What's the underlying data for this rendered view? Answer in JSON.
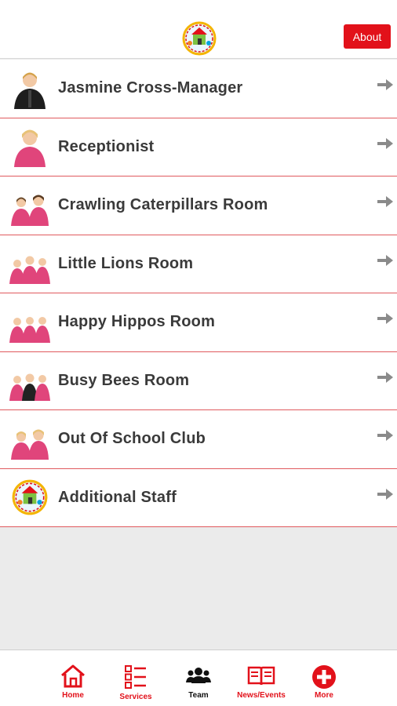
{
  "header": {
    "about_label": "About"
  },
  "items": [
    {
      "label": "Jasmine Cross-Manager",
      "thumb": "person-single-black"
    },
    {
      "label": "Receptionist",
      "thumb": "person-single-pink"
    },
    {
      "label": "Crawling Caterpillars Room",
      "thumb": "people-two-pink"
    },
    {
      "label": "Little Lions Room",
      "thumb": "people-three-pink"
    },
    {
      "label": "Happy Hippos Room",
      "thumb": "people-three-pink"
    },
    {
      "label": "Busy Bees Room",
      "thumb": "people-three-mixed"
    },
    {
      "label": "Out Of School Club",
      "thumb": "people-two-pink"
    },
    {
      "label": "Additional Staff",
      "thumb": "logo-badge"
    }
  ],
  "tabs": [
    {
      "label": "Home",
      "icon": "home-icon",
      "color": "#e2111a"
    },
    {
      "label": "Services",
      "icon": "checklist-icon",
      "color": "#e2111a"
    },
    {
      "label": "Team",
      "icon": "team-icon",
      "color": "#111111"
    },
    {
      "label": "News/Events",
      "icon": "book-icon",
      "color": "#e2111a"
    },
    {
      "label": "More",
      "icon": "plus-circle-icon",
      "color": "#e2111a"
    }
  ],
  "colors": {
    "accent": "#e2111a",
    "divider": "#e05a5e",
    "text": "#3a3a3a"
  }
}
